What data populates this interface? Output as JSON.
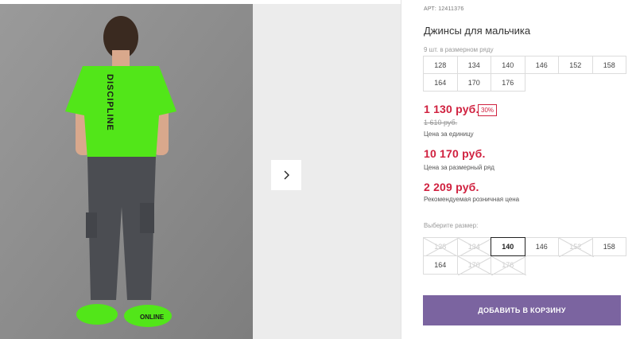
{
  "product": {
    "article_label": "АРТ:",
    "article_value": "12411376",
    "title": "Джинсы для мальчика",
    "row_note": "9 шт. в размерном ряду",
    "row_sizes": [
      "128",
      "134",
      "140",
      "146",
      "152",
      "158",
      "164",
      "170",
      "176"
    ],
    "price_unit": "1 130 руб.",
    "discount": "30%",
    "old_price": "1 610 руб.",
    "price_unit_caption": "Цена за единицу",
    "price_row": "10 170 руб.",
    "price_row_caption": "Цена за размерный ряд",
    "price_retail": "2 209 руб.",
    "price_retail_caption": "Рекомендуемая розничная цена",
    "choose_label": "Выберите размер:",
    "choose_sizes": [
      {
        "label": "128",
        "available": false
      },
      {
        "label": "134",
        "available": false
      },
      {
        "label": "140",
        "available": true,
        "selected": true
      },
      {
        "label": "146",
        "available": true
      },
      {
        "label": "152",
        "available": false
      },
      {
        "label": "158",
        "available": true
      },
      {
        "label": "164",
        "available": true
      },
      {
        "label": "170",
        "available": false
      },
      {
        "label": "176",
        "available": false
      }
    ],
    "add_to_cart": "ДОБАВИТЬ В КОРЗИНУ"
  },
  "gallery": {
    "shirt_print": "DISCIPLINE",
    "shoe_print": "ONLINE",
    "next_icon": "chevron-right-icon"
  },
  "colors": {
    "price": "#d0213f",
    "button": "#7b64a0",
    "shirt": "#52e619"
  }
}
